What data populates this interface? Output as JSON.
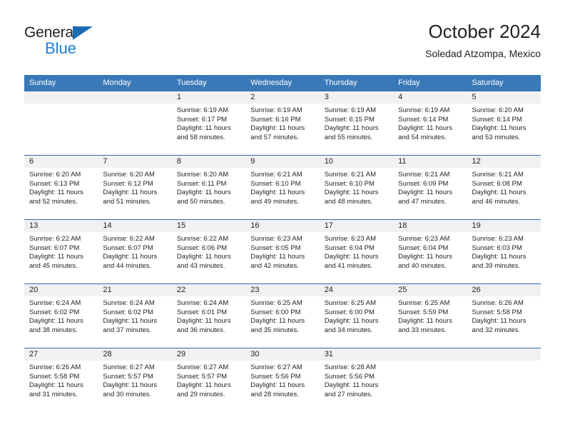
{
  "brand": {
    "name_part1": "General",
    "name_part2": "Blue",
    "logo_icon": "triangle-flag-icon",
    "accent_color": "#1b7fd4"
  },
  "header": {
    "title": "October 2024",
    "subtitle": "Soledad Atzompa, Mexico"
  },
  "calendar": {
    "header_bg": "#3a79b8",
    "daynum_band_bg": "#f1f1f1",
    "row_border_color": "#2f6fae",
    "weekdays": [
      "Sunday",
      "Monday",
      "Tuesday",
      "Wednesday",
      "Thursday",
      "Friday",
      "Saturday"
    ],
    "weeks": [
      [
        {
          "day": "",
          "sunrise": "",
          "sunset": "",
          "daylight": ""
        },
        {
          "day": "",
          "sunrise": "",
          "sunset": "",
          "daylight": ""
        },
        {
          "day": "1",
          "sunrise": "Sunrise: 6:19 AM",
          "sunset": "Sunset: 6:17 PM",
          "daylight": "Daylight: 11 hours and 58 minutes."
        },
        {
          "day": "2",
          "sunrise": "Sunrise: 6:19 AM",
          "sunset": "Sunset: 6:16 PM",
          "daylight": "Daylight: 11 hours and 57 minutes."
        },
        {
          "day": "3",
          "sunrise": "Sunrise: 6:19 AM",
          "sunset": "Sunset: 6:15 PM",
          "daylight": "Daylight: 11 hours and 55 minutes."
        },
        {
          "day": "4",
          "sunrise": "Sunrise: 6:19 AM",
          "sunset": "Sunset: 6:14 PM",
          "daylight": "Daylight: 11 hours and 54 minutes."
        },
        {
          "day": "5",
          "sunrise": "Sunrise: 6:20 AM",
          "sunset": "Sunset: 6:14 PM",
          "daylight": "Daylight: 11 hours and 53 minutes."
        }
      ],
      [
        {
          "day": "6",
          "sunrise": "Sunrise: 6:20 AM",
          "sunset": "Sunset: 6:13 PM",
          "daylight": "Daylight: 11 hours and 52 minutes."
        },
        {
          "day": "7",
          "sunrise": "Sunrise: 6:20 AM",
          "sunset": "Sunset: 6:12 PM",
          "daylight": "Daylight: 11 hours and 51 minutes."
        },
        {
          "day": "8",
          "sunrise": "Sunrise: 6:20 AM",
          "sunset": "Sunset: 6:11 PM",
          "daylight": "Daylight: 11 hours and 50 minutes."
        },
        {
          "day": "9",
          "sunrise": "Sunrise: 6:21 AM",
          "sunset": "Sunset: 6:10 PM",
          "daylight": "Daylight: 11 hours and 49 minutes."
        },
        {
          "day": "10",
          "sunrise": "Sunrise: 6:21 AM",
          "sunset": "Sunset: 6:10 PM",
          "daylight": "Daylight: 11 hours and 48 minutes."
        },
        {
          "day": "11",
          "sunrise": "Sunrise: 6:21 AM",
          "sunset": "Sunset: 6:09 PM",
          "daylight": "Daylight: 11 hours and 47 minutes."
        },
        {
          "day": "12",
          "sunrise": "Sunrise: 6:21 AM",
          "sunset": "Sunset: 6:08 PM",
          "daylight": "Daylight: 11 hours and 46 minutes."
        }
      ],
      [
        {
          "day": "13",
          "sunrise": "Sunrise: 6:22 AM",
          "sunset": "Sunset: 6:07 PM",
          "daylight": "Daylight: 11 hours and 45 minutes."
        },
        {
          "day": "14",
          "sunrise": "Sunrise: 6:22 AM",
          "sunset": "Sunset: 6:07 PM",
          "daylight": "Daylight: 11 hours and 44 minutes."
        },
        {
          "day": "15",
          "sunrise": "Sunrise: 6:22 AM",
          "sunset": "Sunset: 6:06 PM",
          "daylight": "Daylight: 11 hours and 43 minutes."
        },
        {
          "day": "16",
          "sunrise": "Sunrise: 6:23 AM",
          "sunset": "Sunset: 6:05 PM",
          "daylight": "Daylight: 11 hours and 42 minutes."
        },
        {
          "day": "17",
          "sunrise": "Sunrise: 6:23 AM",
          "sunset": "Sunset: 6:04 PM",
          "daylight": "Daylight: 11 hours and 41 minutes."
        },
        {
          "day": "18",
          "sunrise": "Sunrise: 6:23 AM",
          "sunset": "Sunset: 6:04 PM",
          "daylight": "Daylight: 11 hours and 40 minutes."
        },
        {
          "day": "19",
          "sunrise": "Sunrise: 6:23 AM",
          "sunset": "Sunset: 6:03 PM",
          "daylight": "Daylight: 11 hours and 39 minutes."
        }
      ],
      [
        {
          "day": "20",
          "sunrise": "Sunrise: 6:24 AM",
          "sunset": "Sunset: 6:02 PM",
          "daylight": "Daylight: 11 hours and 38 minutes."
        },
        {
          "day": "21",
          "sunrise": "Sunrise: 6:24 AM",
          "sunset": "Sunset: 6:02 PM",
          "daylight": "Daylight: 11 hours and 37 minutes."
        },
        {
          "day": "22",
          "sunrise": "Sunrise: 6:24 AM",
          "sunset": "Sunset: 6:01 PM",
          "daylight": "Daylight: 11 hours and 36 minutes."
        },
        {
          "day": "23",
          "sunrise": "Sunrise: 6:25 AM",
          "sunset": "Sunset: 6:00 PM",
          "daylight": "Daylight: 11 hours and 35 minutes."
        },
        {
          "day": "24",
          "sunrise": "Sunrise: 6:25 AM",
          "sunset": "Sunset: 6:00 PM",
          "daylight": "Daylight: 11 hours and 34 minutes."
        },
        {
          "day": "25",
          "sunrise": "Sunrise: 6:25 AM",
          "sunset": "Sunset: 5:59 PM",
          "daylight": "Daylight: 11 hours and 33 minutes."
        },
        {
          "day": "26",
          "sunrise": "Sunrise: 6:26 AM",
          "sunset": "Sunset: 5:58 PM",
          "daylight": "Daylight: 11 hours and 32 minutes."
        }
      ],
      [
        {
          "day": "27",
          "sunrise": "Sunrise: 6:26 AM",
          "sunset": "Sunset: 5:58 PM",
          "daylight": "Daylight: 11 hours and 31 minutes."
        },
        {
          "day": "28",
          "sunrise": "Sunrise: 6:27 AM",
          "sunset": "Sunset: 5:57 PM",
          "daylight": "Daylight: 11 hours and 30 minutes."
        },
        {
          "day": "29",
          "sunrise": "Sunrise: 6:27 AM",
          "sunset": "Sunset: 5:57 PM",
          "daylight": "Daylight: 11 hours and 29 minutes."
        },
        {
          "day": "30",
          "sunrise": "Sunrise: 6:27 AM",
          "sunset": "Sunset: 5:56 PM",
          "daylight": "Daylight: 11 hours and 28 minutes."
        },
        {
          "day": "31",
          "sunrise": "Sunrise: 6:28 AM",
          "sunset": "Sunset: 5:56 PM",
          "daylight": "Daylight: 11 hours and 27 minutes."
        },
        {
          "day": "",
          "sunrise": "",
          "sunset": "",
          "daylight": ""
        },
        {
          "day": "",
          "sunrise": "",
          "sunset": "",
          "daylight": ""
        }
      ]
    ]
  }
}
